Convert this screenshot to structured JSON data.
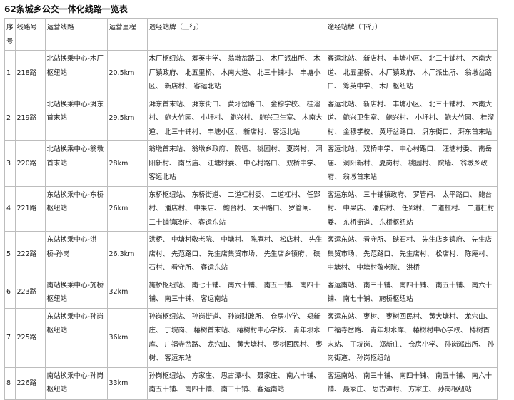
{
  "title": "62条城乡公交一体化线路一览表",
  "headers": {
    "seq": "序号",
    "route_no": "线路号",
    "route_line": "运营线路",
    "mileage": "运营里程",
    "stops_up": "途经站牌（上行）",
    "stops_down": "途经站牌（下行）"
  },
  "rows": [
    {
      "seq": "1",
      "route_no": "218路",
      "route_line": "北站换乘中心-木厂枢纽站",
      "mileage": "20.5km",
      "stops_up": "木厂枢纽站、 筹英中学、 翁墩岔路口、 木厂派出所、 木厂镇政府、 北五里桥、 木南大道、 北三十铺村、 丰塘小区、 新店村、 客运北站",
      "stops_down": "客运北站、 新店村、 丰塘小区、 北三十铺村、 木南大道、 北五里桥、 木厂镇政府、 木厂派出所、 翁墩岔路口、 筹英中学、 木厂枢纽站"
    },
    {
      "seq": "2",
      "route_no": "219路",
      "route_line": "北站换乘中心-湃东首末站",
      "mileage": "29.5km",
      "stops_up": "湃东首末站、 湃东街口、 黄圩岔路口、 金穆学校、 桂溜村、 鲍大竹园、 小圩村、 鲍兴村、 鲍兴卫生室、 木南大道、 北三十铺村、 丰塘小区、 新店村、 客运北站",
      "stops_down": "客运北站、 新店村、 丰塘小区、 北三十铺村、 木南大道、 鲍兴卫生室、 鲍兴村、 小圩村、 鲍大竹园、 桂溜村、 金穆学校、 黄圩岔路口、 湃东街口、 湃东首末站"
    },
    {
      "seq": "3",
      "route_no": "220路",
      "route_line": "北站换乘中心-翁墩首末站",
      "mileage": "28km",
      "stops_up": "翁墩首末站、 翁墩乡政府、 院墙、 桃园村、 夏岗村、 洞阳新村、 南岳庙、 汪塘村委、 中心村路口、 双桥中学、 客运北站",
      "stops_down": "客运北站、 双桥中学、 中心村路口、 汪塘村委、 南岳庙、 洞阳新村、 夏岗村、 桃园村、 院墙、 翁墩乡政府、 翁墩首末站"
    },
    {
      "seq": "4",
      "route_no": "221路",
      "route_line": "东站换乘中心-东桥枢纽站",
      "mileage": "26km",
      "stops_up": "东桥枢纽站、 东桥街道、 二道杠村委、 二道杠村、 任郢村、 潘店村、 中果店、 鲍台村、 太平路口、 罗管闸、 三十铺镇政府、 客运东站",
      "stops_down": "客运东站、 三十铺镇政府、 罗管闸、 太平路口、 鲍台村、 中果店、 潘店村、 任郢村、 二道杠村、 二道杠村委、 东桥街道、 东桥枢纽站"
    },
    {
      "seq": "5",
      "route_no": "222路",
      "route_line": "东站换乘中心-洪桥-孙岗",
      "mileage": "26.3km",
      "stops_up": "洪桥、 中塘村敬老院、 中塘村、 陈庵村、 松店村、 先生店村、 先范路口、 先生店集贸市场、 先生店乡镇府、 硖石村、 看守所、 客运东站",
      "stops_down": "客运东站、 看守所、 硖石村、 先生店乡镇府、 先生店集贸市场、 先范路口、 先生店村、 松店村、 陈庵村、 中塘村、 中塘村敬老院、 洪桥"
    },
    {
      "seq": "6",
      "route_no": "223路",
      "route_line": "南站换乘中心-施桥枢纽站",
      "mileage": "32km",
      "stops_up": "施桥枢纽站、 南七十铺、 南六十铺、 南五十铺、 南四十铺、 南三十铺、 客运南站",
      "stops_down": "客运南站、 南三十铺、 南四十铺、 南五十铺、 南六十铺、 南七十铺、 施桥枢纽站"
    },
    {
      "seq": "7",
      "route_no": "225路",
      "route_line": "东站换乘中心-孙岗枢纽站",
      "mileage": "36km",
      "stops_up": "孙岗枢纽站、 孙岗街道、 孙岗财政所、 仓房小学、 郑新庄、 丁垸岗、 椿树首末站、 椿树村中心学校、 青年坝水库、 广福寺岔路、 龙穴山、 黄大塘村、 枣树回民村、 枣树、 客运东站",
      "stops_down": "客运东站、 枣树、 枣树回民村、 黄大塘村、 龙穴山、 广福寺岔路、 青年坝水库、 椿树村中心学校、 椿树首末站、 丁垸岗、 郑新庄、 仓房小学、 孙岗派出所、 孙岗街道、 孙岗枢纽站"
    },
    {
      "seq": "8",
      "route_no": "226路",
      "route_line": "南站换乘中心-孙岗枢纽站",
      "mileage": "33km",
      "stops_up": "孙岗枢纽站、 方家庄、 思古潭村、 聂家庄、 南六十铺、 南五十铺、 南四十铺、 南三十铺、 客运南站",
      "stops_down": "客运南站、 南三十铺、 南四十铺、 南五十铺、 南六十铺、 聂家庄、 思古潭村、 方家庄、 孙岗枢纽站"
    }
  ]
}
